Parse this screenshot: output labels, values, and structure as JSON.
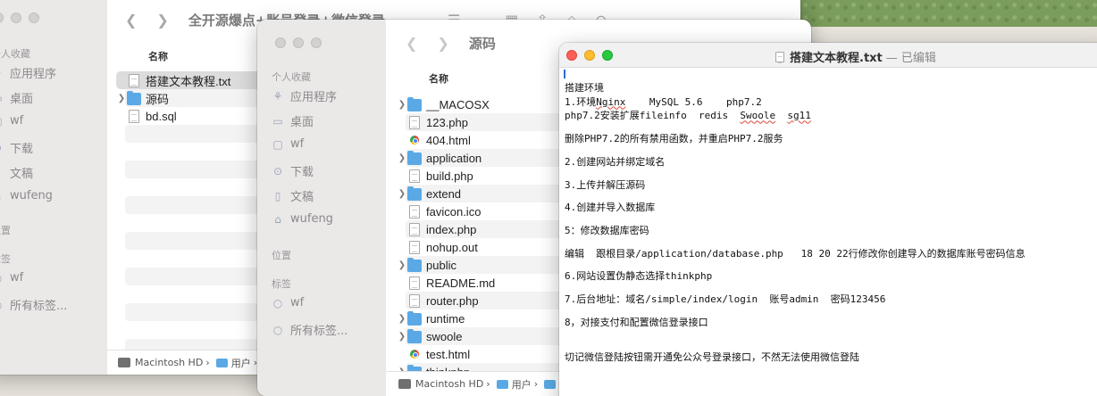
{
  "finder1": {
    "title": "全开源爆点+账号登录+微信登录",
    "sidebar_favorites_head": "个人收藏",
    "sidebar_favorites": [
      "应用程序",
      "桌面",
      "wf",
      "下载",
      "文稿",
      "wufeng"
    ],
    "sidebar_locations_head": "位置",
    "sidebar_tags_head": "标签",
    "sidebar_tags": [
      "wf",
      "所有标签..."
    ],
    "column_name": "名称",
    "files": [
      {
        "name": "搭建文本教程.txt",
        "type": "doc",
        "selected": true,
        "expandable": false
      },
      {
        "name": "源码",
        "type": "folder",
        "selected": false,
        "expandable": true
      },
      {
        "name": "bd.sql",
        "type": "doc",
        "selected": false,
        "expandable": false
      }
    ],
    "path": [
      "Macintosh HD",
      "用户"
    ]
  },
  "finder2": {
    "title": "源码",
    "sidebar_favorites_head": "个人收藏",
    "sidebar_favorites": [
      "应用程序",
      "桌面",
      "wf",
      "下载",
      "文稿",
      "wufeng"
    ],
    "sidebar_locations_head": "位置",
    "sidebar_tags_head": "标签",
    "sidebar_tags": [
      "wf",
      "所有标签..."
    ],
    "column_name": "名称",
    "files": [
      {
        "name": "__MACOSX",
        "type": "folder",
        "expandable": true
      },
      {
        "name": "123.php",
        "type": "doc",
        "expandable": false
      },
      {
        "name": "404.html",
        "type": "html",
        "expandable": false
      },
      {
        "name": "application",
        "type": "folder",
        "expandable": true
      },
      {
        "name": "build.php",
        "type": "doc",
        "expandable": false
      },
      {
        "name": "extend",
        "type": "folder",
        "expandable": true
      },
      {
        "name": "favicon.ico",
        "type": "doc",
        "expandable": false
      },
      {
        "name": "index.php",
        "type": "doc",
        "expandable": false
      },
      {
        "name": "nohup.out",
        "type": "doc",
        "expandable": false
      },
      {
        "name": "public",
        "type": "folder",
        "expandable": true
      },
      {
        "name": "README.md",
        "type": "doc",
        "expandable": false
      },
      {
        "name": "router.php",
        "type": "doc",
        "expandable": false
      },
      {
        "name": "runtime",
        "type": "folder",
        "expandable": true
      },
      {
        "name": "swoole",
        "type": "folder",
        "expandable": true
      },
      {
        "name": "test.html",
        "type": "html",
        "expandable": false
      },
      {
        "name": "thinkphp",
        "type": "folder",
        "expandable": true
      }
    ],
    "path": [
      "Macintosh HD",
      "用户"
    ]
  },
  "editor": {
    "title": "搭建文本教程.txt",
    "status": "— 已编辑",
    "lines": [
      "搭建环境",
      "1.环境Nginx    MySQL 5.6    php7.2",
      "php7.2安装扩展fileinfo  redis  Swoole  sg11",
      "",
      "删除PHP7.2的所有禁用函数，并重启PHP7.2服务",
      "",
      "2.创建网站并绑定域名",
      "",
      "3.上传并解压源码",
      "",
      "4.创建并导入数据库",
      "",
      "5：修改数据库密码",
      "",
      "编辑  跟根目录/application/database.php   18 20 22行修改你创建导入的数据库账号密码信息",
      "",
      "6.网站设置伪静态选择thinkphp",
      "",
      "7.后台地址：域名/simple/index/login  账号admin  密码123456",
      "",
      "8，对接支付和配置微信登录接口",
      "",
      "",
      "切记微信登陆按钮需开通免公众号登录接口，不然无法使用微信登陆"
    ]
  }
}
